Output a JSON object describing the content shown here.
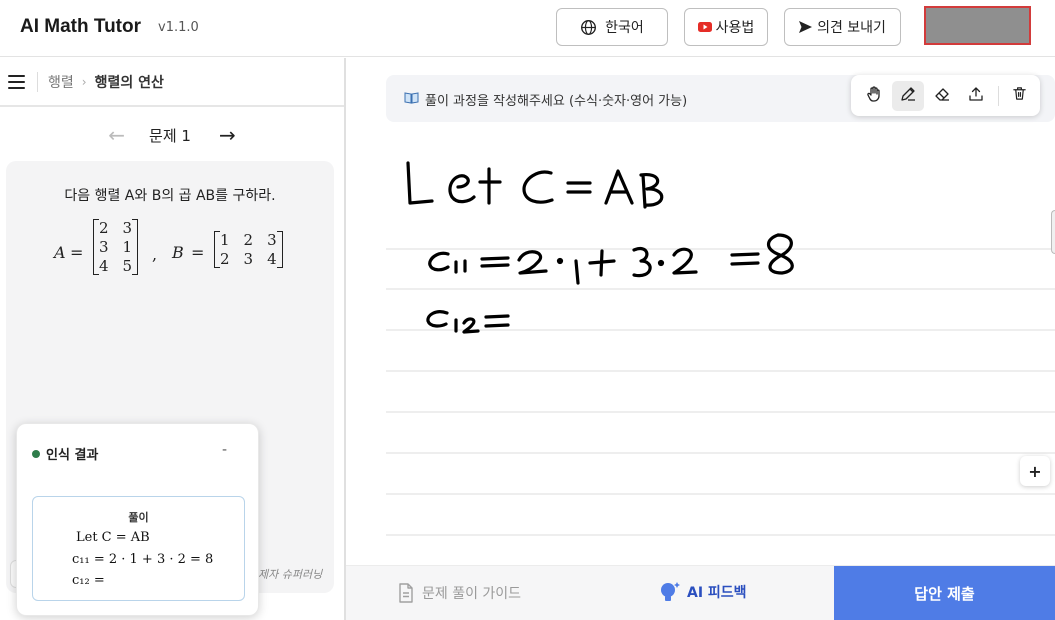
{
  "header": {
    "app_title": "AI Math Tutor",
    "version": "v1.1.0",
    "language_label": "한국어",
    "usage_label": "사용법",
    "feedback_label": "의견 보내기"
  },
  "breadcrumb": {
    "item1": "행렬",
    "separator": "›",
    "item2": "행렬의 연산"
  },
  "problem_nav": {
    "prev": "←",
    "title": "문제 1",
    "next": "→"
  },
  "problem": {
    "text": "다음 행렬 A와 B의 곱 AB를 구하라.",
    "var_a": "A",
    "var_b": "B",
    "eq": "=",
    "comma": ",",
    "matrix_a": [
      "2",
      "3",
      "3",
      "1",
      "4",
      "5"
    ],
    "matrix_b": [
      "1",
      "2",
      "3",
      "2",
      "3",
      "4"
    ]
  },
  "provider_text": "제자 슈퍼러닝",
  "recognition": {
    "title": "인식 결과",
    "minimize": "-",
    "label": "풀이",
    "line1": "Let C = AB",
    "line2": "c₁₁ = 2 · 1 + 3 · 2 = 8",
    "line3": "c₁₂ ="
  },
  "canvas": {
    "instruction": "풀이 과정을 작성해주세요 (수식·숫자·영어 가능)",
    "tools": [
      "hand-icon",
      "pen-icon",
      "eraser-icon",
      "upload-icon",
      "trash-icon"
    ],
    "active_tool": "pen-icon",
    "plus": "+"
  },
  "bottom": {
    "guide_label": "문제 풀이 가이드",
    "ai_label": "AI 피드백",
    "submit_label": "답안 제출"
  },
  "colors": {
    "accent": "#4f7ce6",
    "ai_text": "#2b4fbf",
    "status_dot": "#2f7d4b",
    "youtube_red": "#e52d27"
  }
}
